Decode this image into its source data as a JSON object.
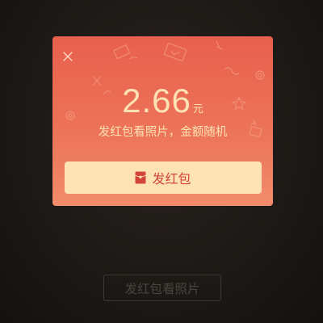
{
  "modal": {
    "amount": "2.66",
    "unit": "元",
    "tagline": "发红包看照片，金额随机",
    "send_button_label": "发红包",
    "close_icon": "close-icon",
    "envelope_icon": "red-envelope-icon"
  },
  "background": {
    "button_label": "发红包看照片"
  },
  "colors": {
    "modal_top": "#e8604e",
    "modal_bottom": "#f28c6c",
    "gold_text": "#fde2b4",
    "button_text": "#d2463a",
    "page_bg": "#1c1916"
  }
}
